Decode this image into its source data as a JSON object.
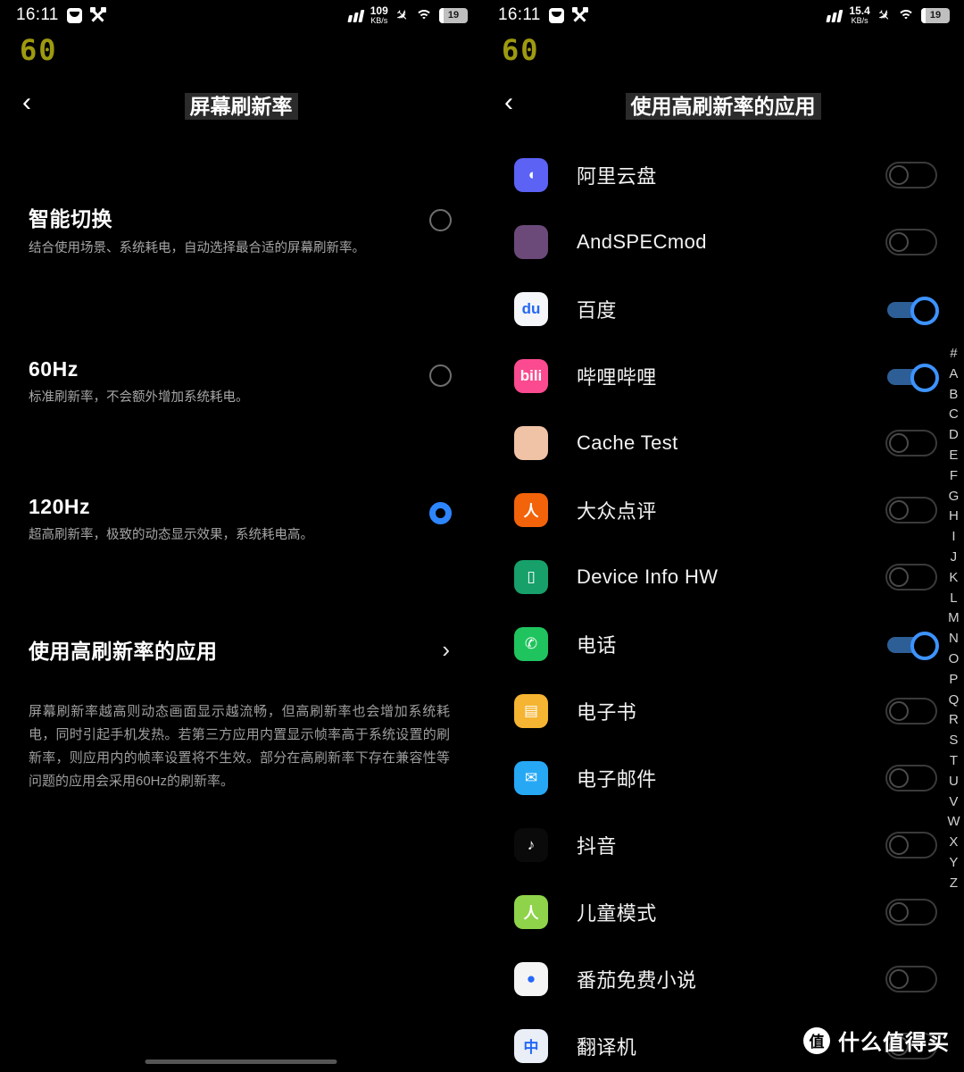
{
  "left": {
    "statusbar": {
      "time": "16:11",
      "mail_icon": "mail-icon",
      "tools_icon": "tools-icon",
      "signal_icon": "signal-bars-icon",
      "net_speed_value": "109",
      "net_speed_unit": "KB/s",
      "airplane_icon": "airplane-icon",
      "wifi_icon": "wifi-icon",
      "battery_level": "19"
    },
    "fps_overlay": "60",
    "title": "屏幕刷新率",
    "back_icon": "back-chevron-icon",
    "options": [
      {
        "title": "智能切换",
        "desc": "结合使用场景、系统耗电，自动选择最合适的屏幕刷新率。",
        "selected": false
      },
      {
        "title": "60Hz",
        "desc": "标准刷新率，不会额外增加系统耗电。",
        "selected": false
      },
      {
        "title": "120Hz",
        "desc": "超高刷新率，极致的动态显示效果，系统耗电高。",
        "selected": true
      }
    ],
    "link_row": {
      "label": "使用高刷新率的应用",
      "chevron": "›"
    },
    "footnote": "屏幕刷新率越高则动态画面显示越流畅，但高刷新率也会增加系统耗电，同时引起手机发热。若第三方应用内置显示帧率高于系统设置的刷新率，则应用内的帧率设置将不生效。部分在高刷新率下存在兼容性等问题的应用会采用60Hz的刷新率。"
  },
  "right": {
    "statusbar": {
      "time": "16:11",
      "mail_icon": "mail-icon",
      "tools_icon": "tools-icon",
      "signal_icon": "signal-bars-icon",
      "net_speed_value": "15.4",
      "net_speed_unit": "KB/s",
      "airplane_icon": "airplane-icon",
      "wifi_icon": "wifi-icon",
      "battery_level": "19"
    },
    "fps_overlay": "60",
    "title": "使用高刷新率的应用",
    "back_icon": "back-chevron-icon",
    "apps": [
      {
        "name": "阿里云盘",
        "enabled": false,
        "icon": "aliyun-drive-icon",
        "icon_bg": "#5b62f4",
        "glyph": "◖"
      },
      {
        "name": "AndSPECmod",
        "enabled": false,
        "icon": "andspecmod-icon",
        "icon_bg": "#6b4a7a",
        "glyph": ""
      },
      {
        "name": "百度",
        "enabled": true,
        "icon": "baidu-icon",
        "icon_bg": "#f4f6fa",
        "glyph": "du"
      },
      {
        "name": "哔哩哔哩",
        "enabled": true,
        "icon": "bilibili-icon",
        "icon_bg": "#fb4a8f",
        "glyph": "bili"
      },
      {
        "name": "Cache Test",
        "enabled": false,
        "icon": "cache-test-icon",
        "icon_bg": "#f0c3a6",
        "glyph": ""
      },
      {
        "name": "大众点评",
        "enabled": false,
        "icon": "dianping-icon",
        "icon_bg": "#f2630a",
        "glyph": "人"
      },
      {
        "name": "Device Info HW",
        "enabled": false,
        "icon": "device-info-hw-icon",
        "icon_bg": "#17a06a",
        "glyph": "▯"
      },
      {
        "name": "电话",
        "enabled": true,
        "icon": "phone-icon",
        "icon_bg": "#20c45e",
        "glyph": "✆"
      },
      {
        "name": "电子书",
        "enabled": false,
        "icon": "ebook-icon",
        "icon_bg": "#f5b431",
        "glyph": "▤"
      },
      {
        "name": "电子邮件",
        "enabled": false,
        "icon": "email-icon",
        "icon_bg": "#27a8f5",
        "glyph": "✉"
      },
      {
        "name": "抖音",
        "enabled": false,
        "icon": "douyin-icon",
        "icon_bg": "#0a0a0a",
        "glyph": "♪"
      },
      {
        "name": "儿童模式",
        "enabled": false,
        "icon": "kids-mode-icon",
        "icon_bg": "#8ed34a",
        "glyph": "人"
      },
      {
        "name": "番茄免费小说",
        "enabled": false,
        "icon": "tomato-novel-icon",
        "icon_bg": "#f4f4f4",
        "glyph": "●"
      },
      {
        "name": "翻译机",
        "enabled": false,
        "icon": "translator-icon",
        "icon_bg": "#e9eef7",
        "glyph": "中"
      }
    ],
    "index_letters": [
      "#",
      "A",
      "B",
      "C",
      "D",
      "E",
      "F",
      "G",
      "H",
      "I",
      "J",
      "K",
      "L",
      "M",
      "N",
      "O",
      "P",
      "Q",
      "R",
      "S",
      "T",
      "U",
      "V",
      "W",
      "X",
      "Y",
      "Z"
    ]
  },
  "watermark": {
    "badge": "值",
    "text": "什么值得买"
  },
  "colors": {
    "accent_blue": "#2e86ff",
    "toggle_on_track": "#2d5f96",
    "toggle_on_knob": "#3d93ff",
    "fps_olive": "#9e9a10",
    "background": "#000000"
  }
}
